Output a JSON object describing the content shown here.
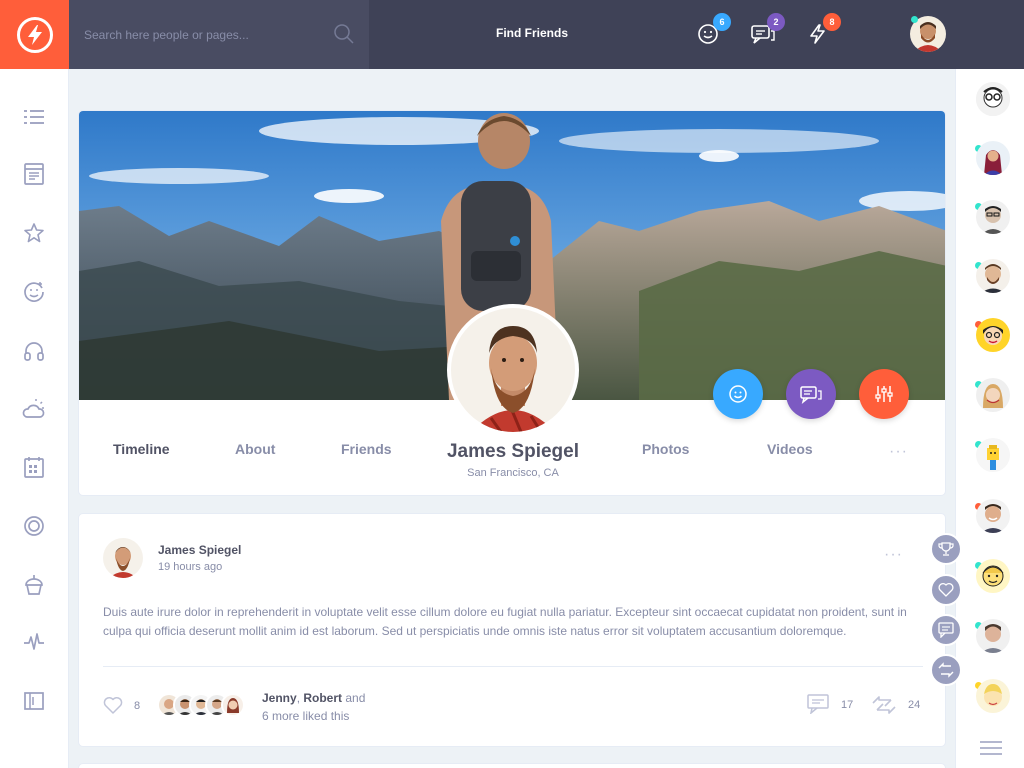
{
  "header": {
    "search_placeholder": "Search here people or pages...",
    "find_friends_label": "Find Friends",
    "notifications": [
      {
        "icon": "smiley-icon",
        "count": "6",
        "color": "#38a9ff"
      },
      {
        "icon": "chat-icon",
        "count": "2",
        "color": "#7c5ac2"
      },
      {
        "icon": "thunder-icon",
        "count": "8",
        "color": "#ff5e3a"
      }
    ]
  },
  "left_sidebar": {
    "items": [
      "menu-icon",
      "newsfeed-icon",
      "star-icon",
      "happy-face-icon",
      "headphones-icon",
      "weather-icon",
      "calendar-icon",
      "badge-icon",
      "cupcake-icon",
      "stats-icon",
      "manage-widgets-icon"
    ]
  },
  "profile": {
    "name": "James Spiegel",
    "location": "San Francisco, CA",
    "tabs": {
      "timeline": "Timeline",
      "about": "About",
      "friends": "Friends",
      "photos": "Photos",
      "videos": "Videos"
    },
    "more": "···",
    "action_colors": {
      "add_friend": "#38a9ff",
      "message": "#7c5ac2",
      "settings": "#ff5e3a"
    }
  },
  "post": {
    "author": "James Spiegel",
    "time": "19 hours ago",
    "more": "···",
    "text": "Duis aute irure dolor in reprehenderit in voluptate velit esse cillum dolore eu fugiat nulla pariatur. Excepteur sint occaecat cupidatat non proident, sunt in culpa qui officia deserunt mollit anim id est laborum. Sed ut perspiciatis unde omnis iste natus error sit voluptatem accusantium doloremque.",
    "likes": "8",
    "liked_by_1": "Jenny",
    "liked_by_sep": ", ",
    "liked_by_2": "Robert",
    "liked_by_and": " and",
    "liked_by_more": "6 more liked this",
    "comments": "17",
    "shares": "24"
  }
}
